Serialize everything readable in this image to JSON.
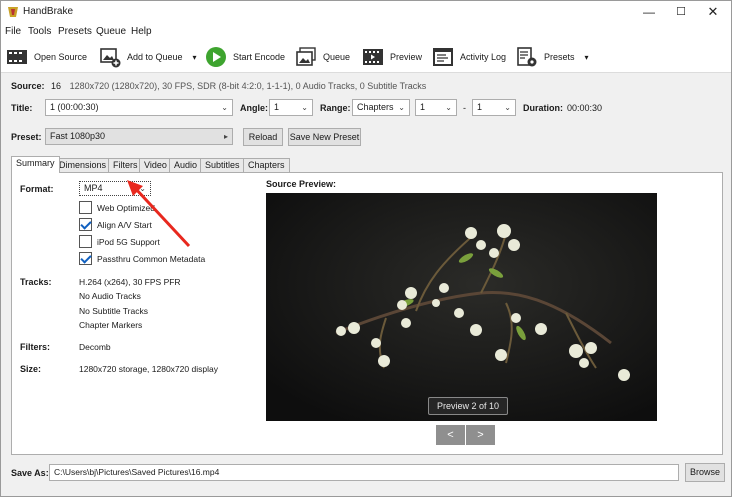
{
  "window": {
    "title": "HandBrake",
    "controls": {
      "minimize": "—",
      "maximize": "☐",
      "close": "✕"
    }
  },
  "menu": [
    "File",
    "Tools",
    "Presets",
    "Queue",
    "Help"
  ],
  "toolbar": {
    "open_source": "Open Source",
    "add_to_queue": "Add to Queue",
    "start_encode": "Start Encode",
    "queue": "Queue",
    "preview": "Preview",
    "activity_log": "Activity Log",
    "presets": "Presets"
  },
  "source": {
    "label": "Source:",
    "name": "16",
    "info": "1280x720 (1280x720), 30 FPS, SDR (8-bit 4:2:0, 1-1-1), 0 Audio Tracks, 0 Subtitle Tracks"
  },
  "title_row": {
    "title_label": "Title:",
    "title_value": "1 (00:00:30)",
    "angle_label": "Angle:",
    "angle_value": "1",
    "range_label": "Range:",
    "range_type": "Chapters",
    "range_start": "1",
    "range_sep": "-",
    "range_end": "1",
    "duration_label": "Duration:",
    "duration_value": "00:00:30"
  },
  "preset_row": {
    "label": "Preset:",
    "value": "Fast 1080p30",
    "reload": "Reload",
    "save_new": "Save New Preset"
  },
  "tabs": [
    "Summary",
    "Dimensions",
    "Filters",
    "Video",
    "Audio",
    "Subtitles",
    "Chapters"
  ],
  "summary": {
    "format_label": "Format:",
    "format_value": "MP4",
    "options": [
      {
        "label": "Web Optimized",
        "checked": false
      },
      {
        "label": "Align A/V Start",
        "checked": true
      },
      {
        "label": "iPod 5G Support",
        "checked": false
      },
      {
        "label": "Passthru Common Metadata",
        "checked": true
      }
    ],
    "tracks_label": "Tracks:",
    "tracks": [
      "H.264 (x264), 30 FPS PFR",
      "No Audio Tracks",
      "No Subtitle Tracks",
      "Chapter Markers"
    ],
    "filters_label": "Filters:",
    "filters_value": "Decomb",
    "size_label": "Size:",
    "size_value": "1280x720 storage, 1280x720 display",
    "source_preview_label": "Source Preview:",
    "preview_badge": "Preview 2 of 10",
    "prev": "<",
    "next": ">"
  },
  "save": {
    "label": "Save As:",
    "path": "C:\\Users\\bj\\Pictures\\Saved Pictures\\16.mp4",
    "browse": "Browse"
  },
  "colors": {
    "accent": "#1060c0",
    "annotation_arrow": "#e8281e",
    "start_encode": "#3ea42f"
  }
}
